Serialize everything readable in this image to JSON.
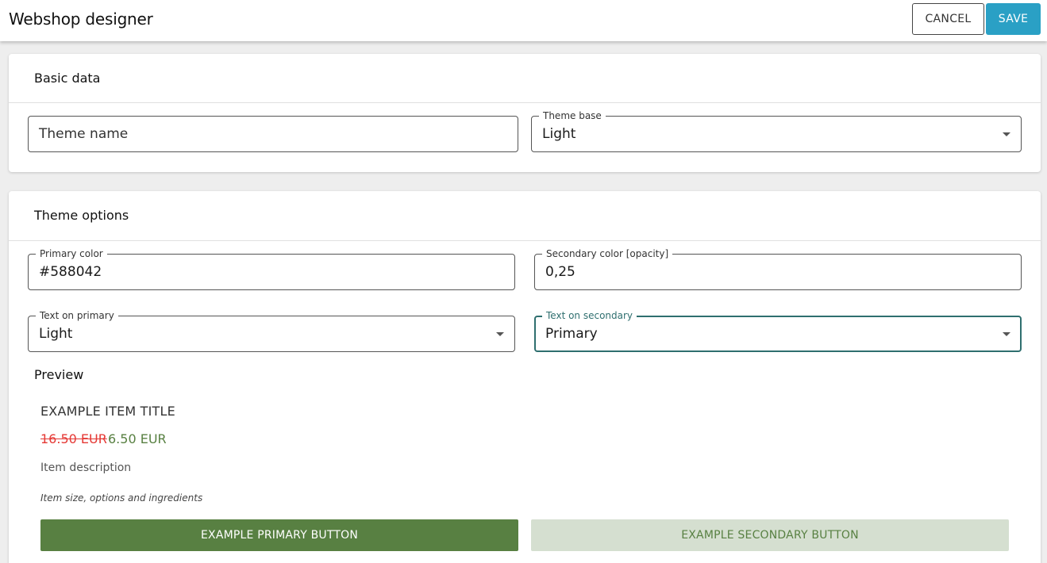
{
  "header": {
    "title": "Webshop designer",
    "cancel_label": "CANCEL",
    "save_label": "SAVE"
  },
  "basic_data": {
    "section_title": "Basic data",
    "theme_name": {
      "placeholder": "Theme name",
      "value": ""
    },
    "theme_base": {
      "label": "Theme base",
      "value": "Light"
    }
  },
  "theme_options": {
    "section_title": "Theme options",
    "primary_color": {
      "label": "Primary color",
      "value": "#588042"
    },
    "secondary_color": {
      "label": "Secondary color [opacity]",
      "value": "0,25"
    },
    "text_on_primary": {
      "label": "Text on primary",
      "value": "Light"
    },
    "text_on_secondary": {
      "label": "Text on secondary",
      "value": "Primary"
    }
  },
  "preview": {
    "section_title": "Preview",
    "item_title": "EXAMPLE ITEM TITLE",
    "old_price": "16.50 EUR",
    "new_price": "6.50 EUR",
    "description": "Item description",
    "size_options": "Item size, options and ingredients",
    "primary_button": "EXAMPLE PRIMARY BUTTON",
    "secondary_button": "EXAMPLE SECONDARY BUTTON"
  },
  "colors": {
    "accent": "#2aa0c5",
    "primary": "#588042",
    "discount": "#e53935",
    "focus": "#2f6f6f"
  },
  "icons": {
    "dropdown": "caret-down-icon"
  }
}
